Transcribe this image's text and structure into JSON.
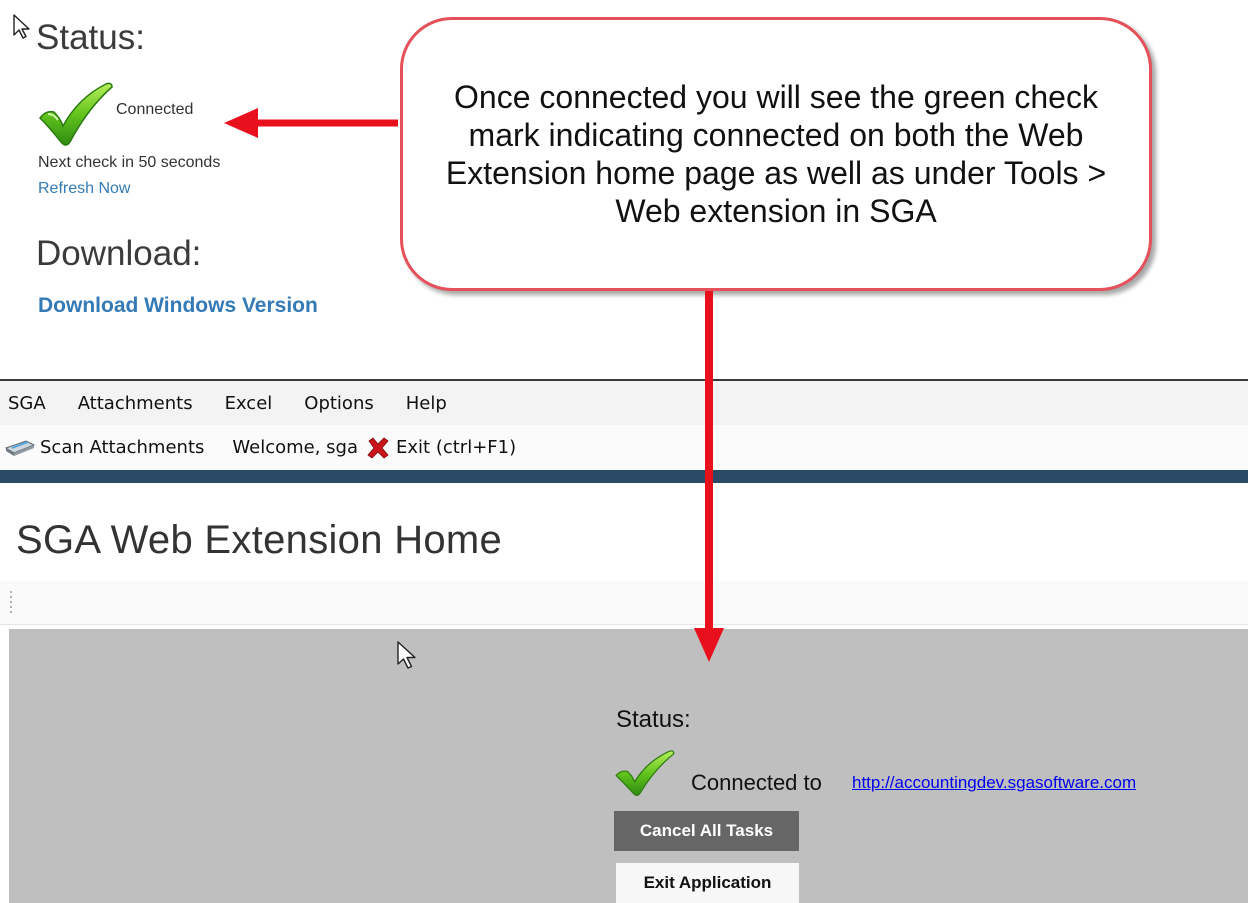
{
  "web_panel": {
    "status_heading": "Status:",
    "connected_label": "Connected",
    "next_check": "Next check in 50 seconds",
    "refresh_link": "Refresh Now",
    "download_heading": "Download:",
    "download_link": "Download Windows Version"
  },
  "callout": {
    "text": "Once connected you will see the green check mark indicating connected on both the Web Extension home page as well as under Tools > Web extension in SGA"
  },
  "menu_bar": {
    "items": [
      "SGA",
      "Attachments",
      "Excel",
      "Options",
      "Help"
    ]
  },
  "toolbar": {
    "scan_label": "Scan Attachments",
    "welcome": "Welcome, sga",
    "exit_label": "Exit (ctrl+F1)"
  },
  "home": {
    "title": "SGA Web Extension Home",
    "status_heading": "Status:",
    "connected_to": "Connected to",
    "server_url": "http://accountingdev.sgasoftware.com",
    "cancel_button": "Cancel All Tasks",
    "exit_button": "Exit Application"
  },
  "colors": {
    "accent_link": "#337ab7",
    "callout_border": "#e5505b",
    "arrow": "#e8101c",
    "nav_strip": "#2b4a66",
    "check_green": "#5cc21c"
  },
  "icons": [
    "check-icon",
    "scanner-icon",
    "red-x-icon",
    "mouse-cursor-icon",
    "grip-icon"
  ]
}
